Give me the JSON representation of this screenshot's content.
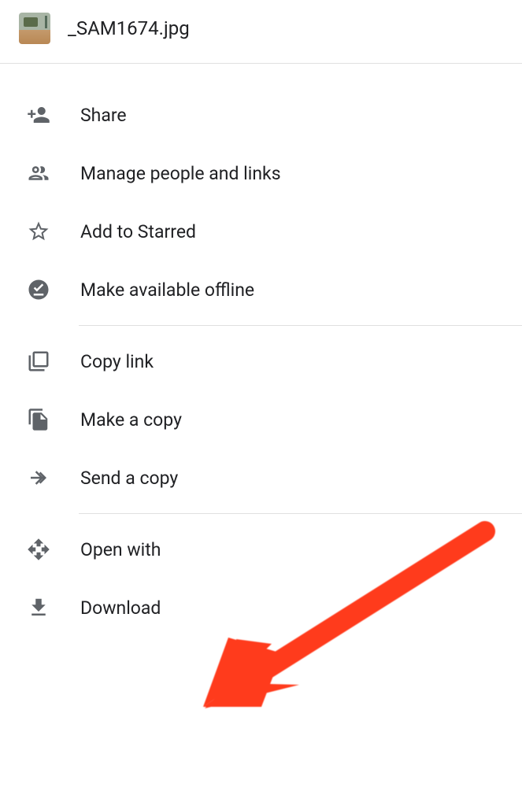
{
  "header": {
    "filename": "_SAM1674.jpg"
  },
  "menu": {
    "share": "Share",
    "manage": "Manage people and links",
    "star": "Add to Starred",
    "offline": "Make available offline",
    "copy_link": "Copy link",
    "make_copy": "Make a copy",
    "send_copy": "Send a copy",
    "open_with": "Open with",
    "download": "Download"
  },
  "annotation": {
    "arrow_color": "#ff3b1f"
  }
}
